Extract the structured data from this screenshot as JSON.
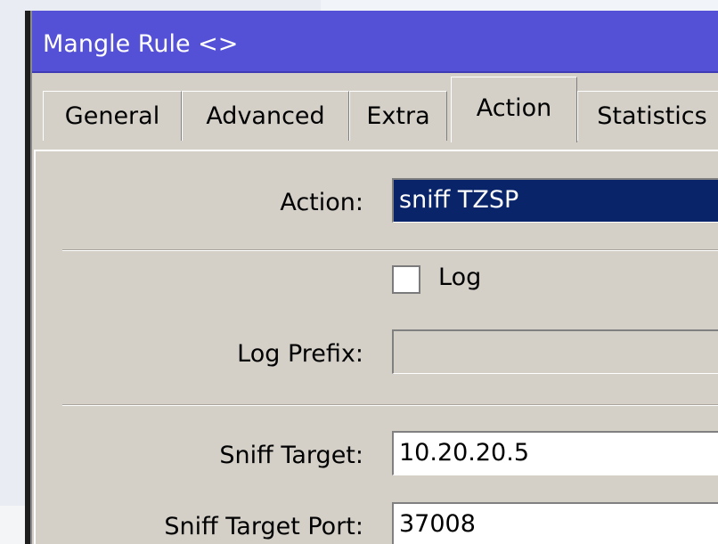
{
  "window": {
    "title": "Mangle Rule <>"
  },
  "tabs": [
    {
      "label": "General",
      "active": false
    },
    {
      "label": "Advanced",
      "active": false
    },
    {
      "label": "Extra",
      "active": false
    },
    {
      "label": "Action",
      "active": true
    },
    {
      "label": "Statistics",
      "active": false
    }
  ],
  "form": {
    "action_label": "Action:",
    "action_value": "sniff TZSP",
    "log_label": "Log",
    "log_checked": false,
    "log_prefix_label": "Log Prefix:",
    "log_prefix_value": "",
    "sniff_target_label": "Sniff Target:",
    "sniff_target_value": "10.20.20.5",
    "sniff_target_port_label": "Sniff Target Port:",
    "sniff_target_port_value": "37008"
  },
  "colors": {
    "titlebar": "#5551d6",
    "window_face": "#d4d0c8",
    "selection": "#0a246a"
  }
}
